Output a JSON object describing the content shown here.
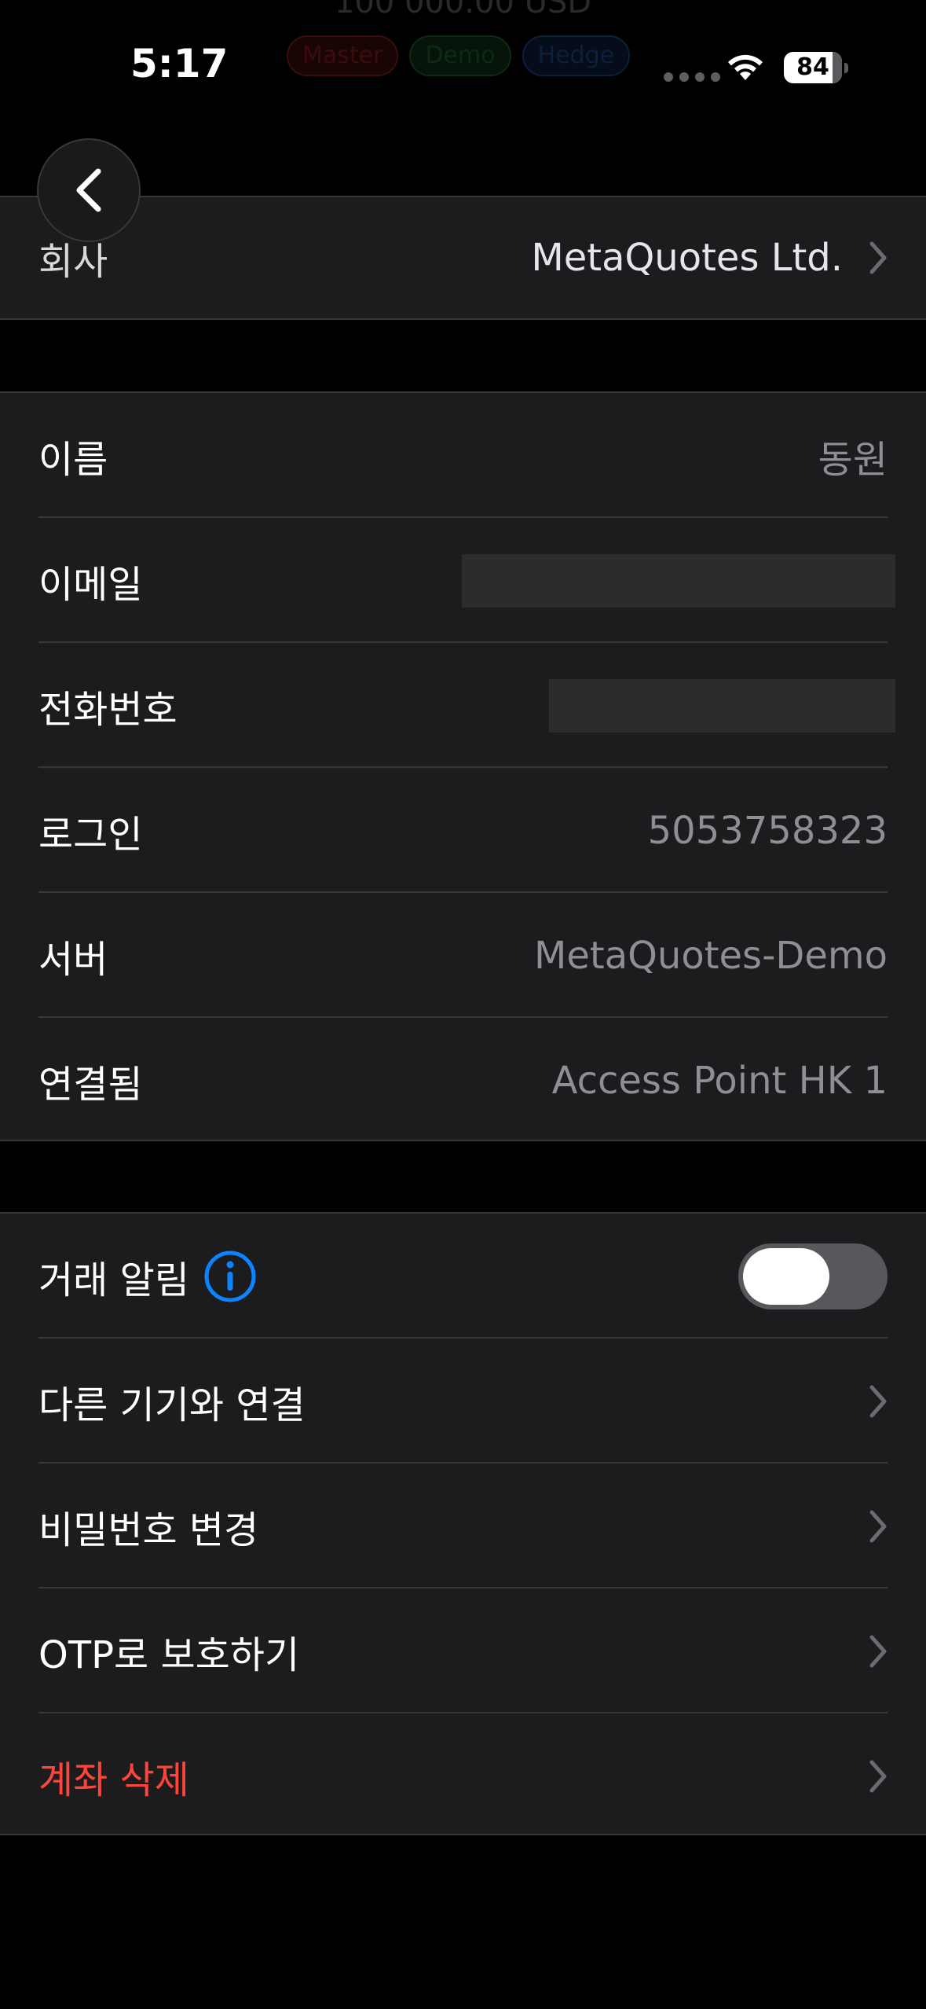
{
  "status_bar": {
    "time": "5:17",
    "battery_percent": "84",
    "battery_level": 0.84,
    "behind_header_balance": "100 000.00 USD",
    "behind_header_tags": [
      "Master",
      "Demo",
      "Hedge"
    ]
  },
  "nav": {
    "back_icon": "chevron-left-icon"
  },
  "company_row": {
    "label": "회사",
    "value": "MetaQuotes Ltd."
  },
  "account_rows": [
    {
      "label": "이름",
      "value": "동원"
    },
    {
      "label": "이메일",
      "value": ""
    },
    {
      "label": "전화번호",
      "value": ""
    },
    {
      "label": "로그인",
      "value": "5053758323"
    },
    {
      "label": "서버",
      "value": "MetaQuotes-Demo"
    },
    {
      "label": "연결됨",
      "value": "Access Point HK 1"
    }
  ],
  "actions": {
    "trade_alerts": {
      "label": "거래 알림",
      "info_icon": "info-circle-icon",
      "enabled": false
    },
    "connect_device": {
      "label": "다른 기기와 연결"
    },
    "change_password": {
      "label": "비밀번호 변경"
    },
    "otp_protect": {
      "label": "OTP로 보호하기"
    },
    "delete_account": {
      "label": "계좌 삭제"
    }
  },
  "colors": {
    "background": "#000000",
    "cell_background": "#1c1c1e",
    "separator": "#38383a",
    "secondary_text": "#8e8e93",
    "danger": "#ff453a",
    "info_blue": "#0a84ff"
  }
}
